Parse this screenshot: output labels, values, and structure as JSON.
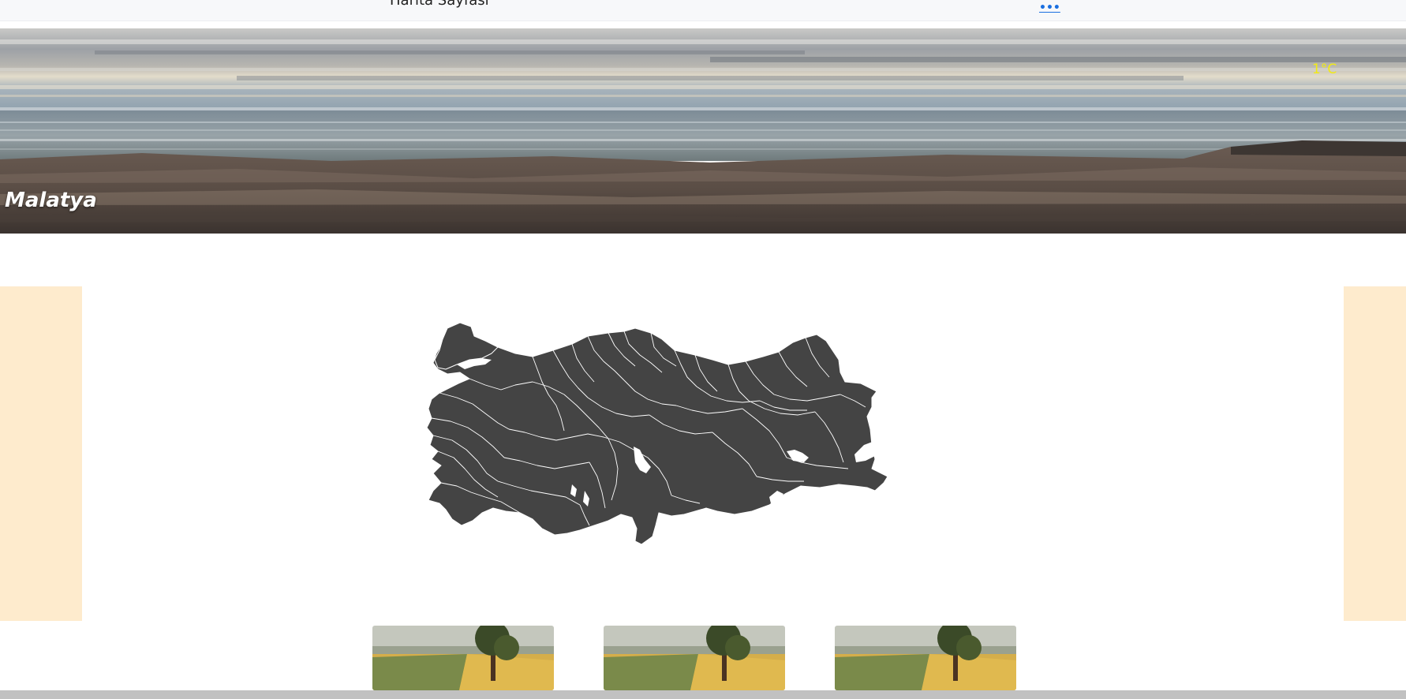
{
  "topbar": {
    "title": "Harita Sayfası",
    "more_link": "•••"
  },
  "hero": {
    "city": "Malatya",
    "temperature": "1°C"
  },
  "colors": {
    "side_panel": "#feebcd",
    "map_fill": "#444444",
    "temperature_text": "#f2ea14",
    "link": "#1a6fe0"
  },
  "map": {
    "region": "Türkiye"
  },
  "thumbnails": [
    {
      "icon": "landscape-painting-thumbnail"
    },
    {
      "icon": "landscape-painting-thumbnail"
    },
    {
      "icon": "landscape-painting-thumbnail"
    }
  ]
}
